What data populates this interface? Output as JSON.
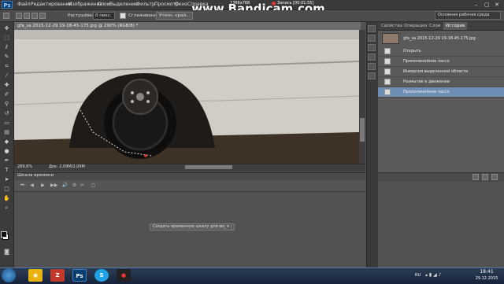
{
  "app": {
    "logo": "Ps",
    "menu": [
      "Файл",
      "Редактирование",
      "Изображение",
      "Слои",
      "Выделение",
      "Фильтр",
      "Просмотр",
      "Окно",
      "Справка"
    ],
    "window_controls": [
      "–",
      "▢",
      "✕"
    ]
  },
  "overlay": {
    "watermark": "www.Bandicam.com",
    "resolution": "1366x768",
    "record_label": "Запись [00:01:55]"
  },
  "options": {
    "feather_label": "Растушёвка:",
    "feather_value": "0 пикс.",
    "antialias_label": "Сглаживание",
    "refine_edge": "Уточн. край...",
    "workspace": "Основная рабочая среда"
  },
  "document": {
    "tab_title": "gfa_sa 2015-12-29 19-18-45-175.jpg @ 290% (RGB/8) *",
    "zoom": "289,6%",
    "size": "Док: 2,09M/2,09M"
  },
  "timeline": {
    "title": "Шкала времени",
    "create_button": "Создать временную шкалу для видео",
    "controls": [
      "⏮",
      "◀",
      "▶",
      "▶▶",
      "🔊",
      "⚙",
      "✂",
      "▢"
    ]
  },
  "panels": {
    "tabs": [
      "Свойства",
      "Операции",
      "Слои",
      "История"
    ],
    "active_tab": "История",
    "history": {
      "snapshot": "gfa_sa 2015-12-29 19-18-45-175.jpg",
      "items": [
        {
          "label": "Открыть",
          "selected": false
        },
        {
          "label": "Прямолинейное лассо",
          "selected": false
        },
        {
          "label": "Инверсия выделенной области",
          "selected": false
        },
        {
          "label": "Размытие в движении",
          "selected": false
        },
        {
          "label": "Прямолинейное лассо",
          "selected": true
        }
      ]
    }
  },
  "taskbar": {
    "apps": [
      {
        "name": "chrome",
        "label": "◉",
        "color": "#e8b20f"
      },
      {
        "name": "filezilla",
        "label": "Z",
        "color": "#c0392b"
      },
      {
        "name": "photoshop",
        "label": "Ps",
        "color": "#0b3d6e"
      },
      {
        "name": "skype",
        "label": "S",
        "color": "#1fa3e6"
      },
      {
        "name": "bandicam",
        "label": "●",
        "color": "#222222"
      }
    ],
    "language": "RU",
    "time": "18:41",
    "date": "29.12.2015"
  },
  "colors": {
    "accent_selected": "#6d8db5",
    "panel_bg": "#5a5a5a",
    "workspace_bg": "#535353"
  }
}
